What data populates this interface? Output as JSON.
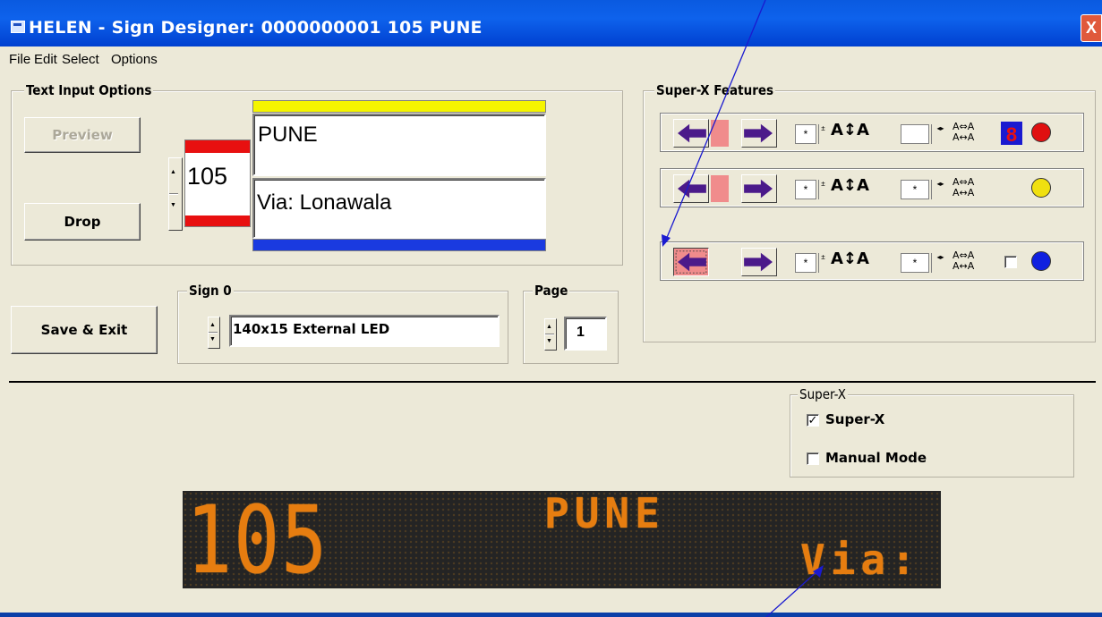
{
  "window": {
    "title": "HELEN - Sign Designer: 0000000001 105 PUNE",
    "close_glyph": "X"
  },
  "menu": [
    "File",
    "Edit",
    "Select",
    "Options"
  ],
  "text_input_options": {
    "legend": "Text Input Options",
    "preview_label": "Preview",
    "drop_label": "Drop",
    "route_number": "105",
    "line1": "PUNE",
    "line2": "Via: Lonawala"
  },
  "sign": {
    "legend": "Sign 0",
    "value": "140x15 External LED"
  },
  "page": {
    "legend": "Page",
    "value": "1"
  },
  "save_exit_label": "Save & Exit",
  "super_x_features": {
    "legend": "Super-X Features",
    "rows": [
      {
        "field1": "*",
        "field2": "",
        "indicator_digit": "8",
        "dot_color": "#e01010"
      },
      {
        "field1": "*",
        "field2": "*",
        "indicator_digit": "",
        "dot_color": "#f0e010"
      },
      {
        "field1": "*",
        "field2": "*",
        "indicator_digit": "",
        "dot_color": "#1020e0"
      }
    ],
    "size_glyph": "A↕A",
    "swap_glyph_top": "A⇔A",
    "swap_glyph_bottom": "A↔A"
  },
  "super_x_group": {
    "legend": "Super-X",
    "super_x_label": "Super-X",
    "super_x_checked": true,
    "manual_label": "Manual Mode",
    "manual_checked": false
  },
  "led_display": {
    "route": "105",
    "destination": "PUNE",
    "via": "Via:"
  },
  "colors": {
    "title_bar": "#0a5ae0",
    "yellow_bar": "#f5f500",
    "blue_bar": "#1a3ae0",
    "red_bar": "#e81010",
    "led_text": "#e67d10",
    "arrow": "#4b1a8a",
    "annotation_arrow": "#1a1ad0"
  }
}
